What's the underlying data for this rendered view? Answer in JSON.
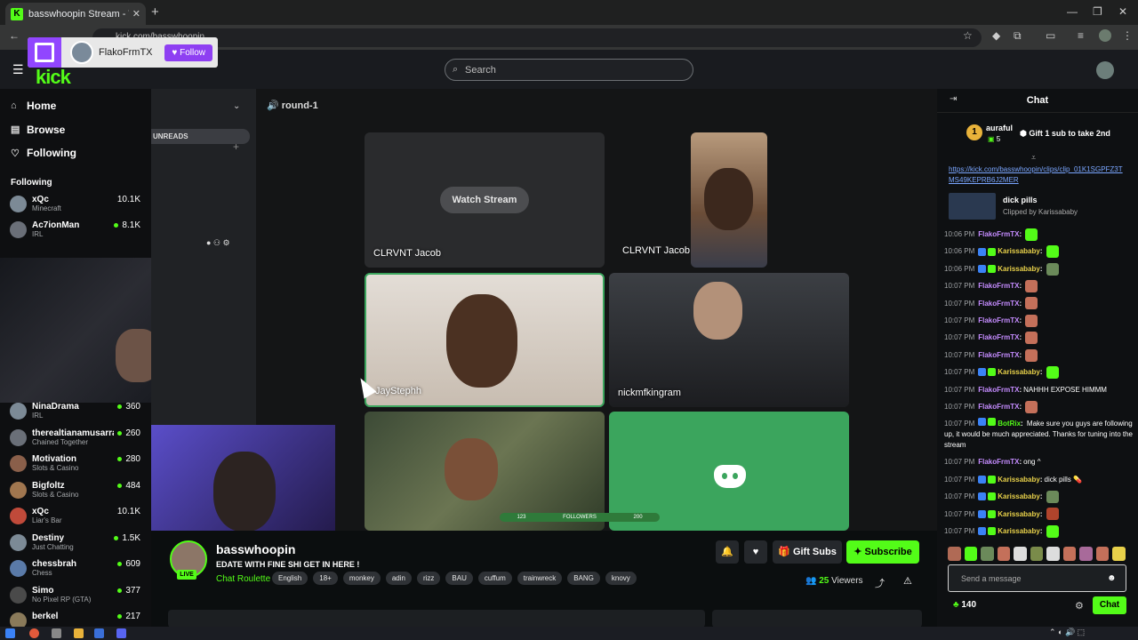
{
  "browser": {
    "tab_title": "basswhoopin Stream - Wat",
    "url": "kick.com/basswhoopin"
  },
  "twitch_overlay": {
    "name": "FlakoFrmTX",
    "follow_label": "Follow"
  },
  "header": {
    "logo_text": "kick",
    "search_placeholder": "Search"
  },
  "nav": {
    "items": [
      {
        "label": "Home",
        "icon": "home-icon"
      },
      {
        "label": "Browse",
        "icon": "compass-icon"
      },
      {
        "label": "Following",
        "icon": "heart-icon"
      }
    ],
    "following_heading": "Following",
    "channels_top": [
      {
        "name": "xQc",
        "category": "Minecraft",
        "viewers": "10.1K"
      },
      {
        "name": "Ac7ionMan",
        "category": "IRL",
        "viewers": "8.1K"
      }
    ],
    "channels_bottom": [
      {
        "name": "NinaDrama",
        "category": "IRL",
        "viewers": "360"
      },
      {
        "name": "therealtianamusarra",
        "category": "Chained Together",
        "viewers": "260"
      },
      {
        "name": "Motivation",
        "category": "Slots & Casino",
        "viewers": "280"
      },
      {
        "name": "Bigfoltz",
        "category": "Slots & Casino",
        "viewers": "484"
      },
      {
        "name": "xQc",
        "category": "Liar's Bar",
        "viewers": "10.1K"
      },
      {
        "name": "Destiny",
        "category": "Just Chatting",
        "viewers": "1.5K"
      },
      {
        "name": "chessbrah",
        "category": "Chess",
        "viewers": "609"
      },
      {
        "name": "Simo",
        "category": "No Pixel RP (GTA)",
        "viewers": "377"
      },
      {
        "name": "berkel",
        "category": "",
        "viewers": "217"
      }
    ]
  },
  "discord": {
    "unreads_label": "UNREADS",
    "channel_name": "round-1",
    "watch_stream_label": "Watch Stream",
    "tiles": [
      {
        "label": "CLRVNT Jacob"
      },
      {
        "label": "CLRVNT Jacob"
      },
      {
        "label": "JayStephh"
      },
      {
        "label": "nickmfkingram"
      }
    ],
    "followers_bar": {
      "left": "123",
      "center": "FOLLOWERS",
      "right": "200"
    }
  },
  "stream": {
    "streamer": "basswhoopin",
    "live_label": "LIVE",
    "title": "EDATE WITH FINE SHI GET IN HERE !",
    "category": "Chat Roulette",
    "tags": [
      "English",
      "18+",
      "monkey",
      "adin",
      "rizz",
      "BAU",
      "cuffum",
      "trainwreck",
      "BANG",
      "knovy"
    ],
    "gift_subs_label": "Gift Subs",
    "subscribe_label": "Subscribe",
    "viewers": "25",
    "viewers_label": "Viewers"
  },
  "chat": {
    "title": "Chat",
    "pinned": {
      "rank": "1",
      "user": "auraful",
      "subs": "5",
      "message": "Gift 1 sub to take 2nd"
    },
    "clip_link": "https://kick.com/basswhoopin/clips/clip_01K1SGPFZ3TMS49KEPRB6J2MER",
    "clip_title": "dick pills",
    "clip_by": "Clipped by Karissababy",
    "messages": [
      {
        "time": "10:06 PM",
        "user": "FlakoFrmTX",
        "text": "",
        "color": "#c58cff",
        "badges": 0,
        "emote": "#53fc18"
      },
      {
        "time": "10:06 PM",
        "user": "Karissababy",
        "text": "",
        "color": "#e8d14a",
        "badges": 2,
        "emote": "#53fc18"
      },
      {
        "time": "10:06 PM",
        "user": "Karissababy",
        "text": "",
        "color": "#e8d14a",
        "badges": 2,
        "emote": "#6b8a5a"
      },
      {
        "time": "10:07 PM",
        "user": "FlakoFrmTX",
        "text": "",
        "color": "#c58cff",
        "badges": 0,
        "emote": "#c4705a"
      },
      {
        "time": "10:07 PM",
        "user": "FlakoFrmTX",
        "text": "",
        "color": "#c58cff",
        "badges": 0,
        "emote": "#c4705a"
      },
      {
        "time": "10:07 PM",
        "user": "FlakoFrmTX",
        "text": "",
        "color": "#c58cff",
        "badges": 0,
        "emote": "#c4705a"
      },
      {
        "time": "10:07 PM",
        "user": "FlakoFrmTX",
        "text": "",
        "color": "#c58cff",
        "badges": 0,
        "emote": "#c4705a"
      },
      {
        "time": "10:07 PM",
        "user": "FlakoFrmTX",
        "text": "",
        "color": "#c58cff",
        "badges": 0,
        "emote": "#c4705a"
      },
      {
        "time": "10:07 PM",
        "user": "Karissababy",
        "text": "",
        "color": "#e8d14a",
        "badges": 2,
        "emote": "#53fc18"
      },
      {
        "time": "10:07 PM",
        "user": "FlakoFrmTX",
        "text": "NAHHH EXPOSE HIMMM",
        "color": "#c58cff",
        "badges": 0,
        "emote": ""
      },
      {
        "time": "10:07 PM",
        "user": "FlakoFrmTX",
        "text": "",
        "color": "#c58cff",
        "badges": 0,
        "emote": "#c4705a"
      },
      {
        "time": "10:07 PM",
        "user": "BotRix",
        "text": "Make sure you guys are following up, it would be much appreciated. Thanks for tuning into the stream",
        "color": "#53fc18",
        "badges": 2,
        "emote": "",
        "wrap": true
      },
      {
        "time": "10:07 PM",
        "user": "FlakoFrmTX",
        "text": "ong ^",
        "color": "#c58cff",
        "badges": 0,
        "emote": ""
      },
      {
        "time": "10:07 PM",
        "user": "Karissababy",
        "text": "dick pills 💊",
        "color": "#e8d14a",
        "badges": 2,
        "emote": ""
      },
      {
        "time": "10:07 PM",
        "user": "Karissababy",
        "text": "",
        "color": "#e8d14a",
        "badges": 2,
        "emote": "#6b8a5a"
      },
      {
        "time": "10:07 PM",
        "user": "Karissababy",
        "text": "",
        "color": "#e8d14a",
        "badges": 2,
        "emote": "#b0442c"
      },
      {
        "time": "10:07 PM",
        "user": "Karissababy",
        "text": "",
        "color": "#e8d14a",
        "badges": 2,
        "emote": "#53fc18"
      }
    ],
    "input_placeholder": "Send a message",
    "points": "140",
    "send_label": "Chat"
  },
  "colors": {
    "accent": "#53fc18",
    "twitch": "#9146ff",
    "discord": "#3ba55d"
  }
}
